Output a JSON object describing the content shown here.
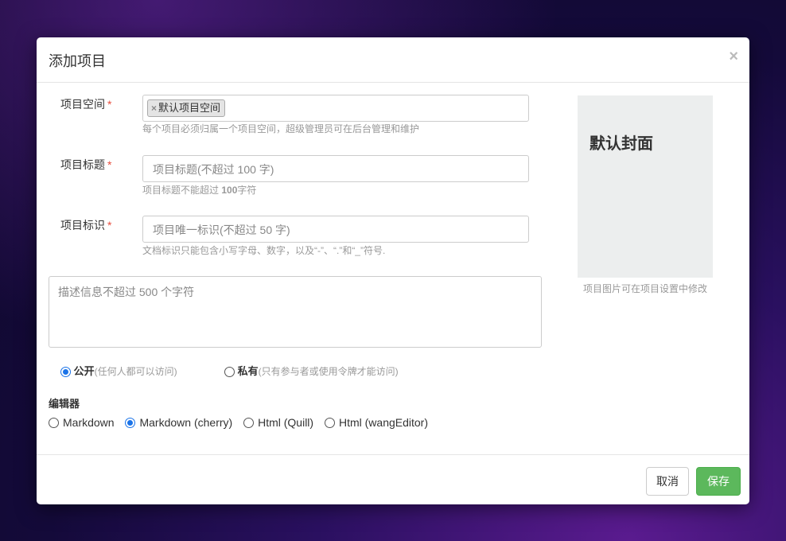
{
  "modal": {
    "title": "添加项目",
    "close_symbol": "×"
  },
  "form": {
    "space": {
      "label": "项目空间",
      "required_mark": "*",
      "tag": "默认项目空间",
      "tag_remove": "×",
      "help": "每个项目必须归属一个项目空间，超级管理员可在后台管理和维护"
    },
    "title": {
      "label": "项目标题",
      "required_mark": "*",
      "placeholder": "项目标题(不超过 100 字)",
      "help_prefix": "项目标题不能超过 ",
      "help_number": "100",
      "help_suffix": "字符"
    },
    "identify": {
      "label": "项目标识",
      "required_mark": "*",
      "placeholder": "项目唯一标识(不超过 50 字)",
      "help": "文档标识只能包含小写字母、数字，以及“-”、“.”和“_”符号."
    },
    "description": {
      "placeholder": "描述信息不超过 500 个字符"
    },
    "visibility": {
      "public_label": "公开",
      "public_note": "(任何人都可以访问)",
      "public_checked": true,
      "private_label": "私有",
      "private_note": "(只有参与者或使用令牌才能访问)",
      "private_checked": false
    },
    "editor": {
      "title": "编辑器",
      "options": [
        {
          "label": "Markdown",
          "checked": false
        },
        {
          "label": "Markdown (cherry)",
          "checked": true
        },
        {
          "label": "Html (Quill)",
          "checked": false
        },
        {
          "label": "Html (wangEditor)",
          "checked": false
        }
      ]
    }
  },
  "cover": {
    "title": "默认封面",
    "help": "项目图片可在项目设置中修改"
  },
  "footer": {
    "cancel_label": "取消",
    "save_label": "保存"
  },
  "colors": {
    "accent": "#1a73e8",
    "save_button": "#5cb85c",
    "required": "#e74c3c"
  }
}
